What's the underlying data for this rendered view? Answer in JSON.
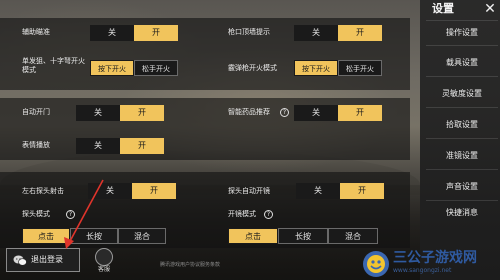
{
  "sidebar": {
    "title": "设置",
    "items": [
      "操作设置",
      "载具设置",
      "灵敏度设置",
      "拾取设置",
      "准镜设置",
      "声音设置",
      "快捷消息"
    ]
  },
  "toggle_off": "关",
  "toggle_on": "开",
  "panel1": {
    "assist_aim": "辅助瞄准",
    "muzzle_hint": "枪口顶墙提示",
    "fire_mode_label": "单发狙、十字弩开火模式",
    "shotgun_label": "霰弹枪开火模式",
    "press_fire": "按下开火",
    "release_fire": "松手开火"
  },
  "panel2": {
    "auto_door": "自动开门",
    "smart_meds": "智能药品推荐",
    "emote": "表情播放"
  },
  "panel3": {
    "peek_fire": "左右探头射击",
    "peek_scope": "探头自动开镜",
    "peek_mode": "探头模式",
    "scope_mode": "开镜模式",
    "tap": "点击",
    "hold": "长按",
    "mixed": "混合"
  },
  "footer": {
    "logout": "退出登录",
    "support": "客服",
    "note": "腾讯游戏用户协议服务条款"
  },
  "watermark": {
    "name": "三公子游戏网",
    "url": "www.sangongzi.net"
  },
  "colors": {
    "accent": "#f1c45c",
    "button_dark": "#1a1a1a",
    "arrow": "#e0342b"
  }
}
